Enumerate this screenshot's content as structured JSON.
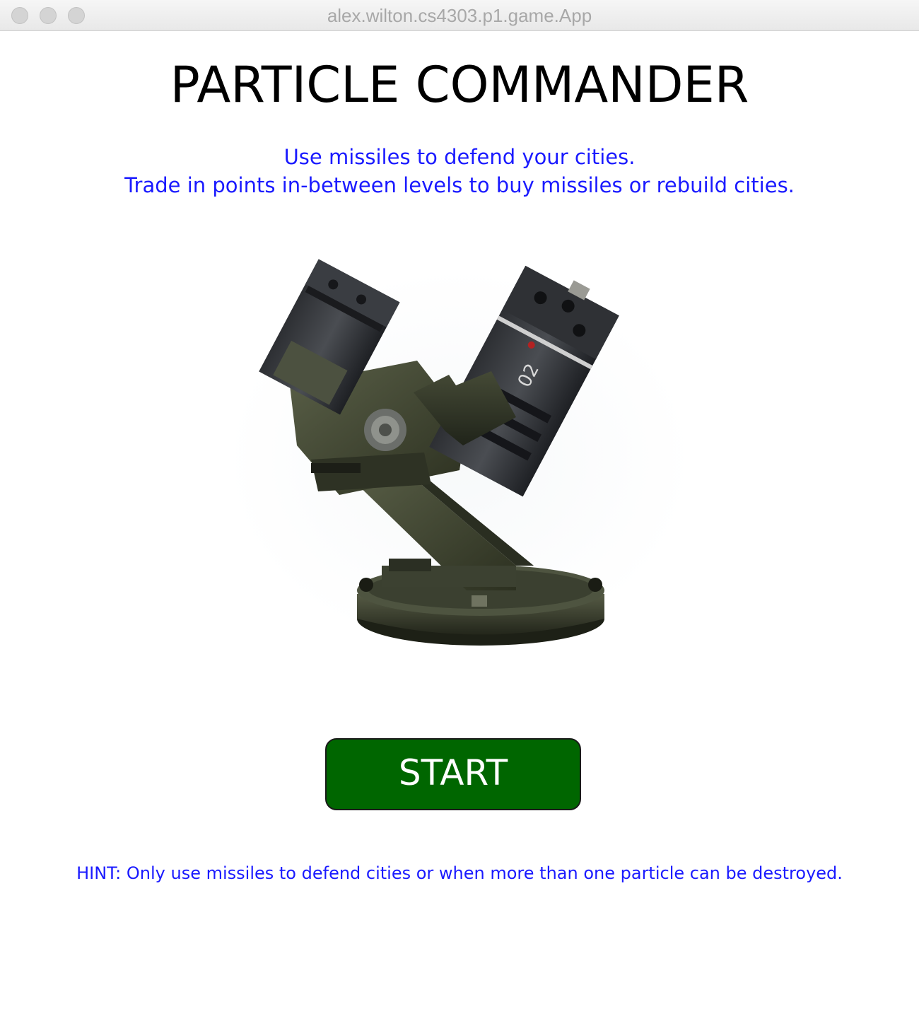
{
  "window": {
    "title": "alex.wilton.cs4303.p1.game.App"
  },
  "menu": {
    "title": "PARTICLE COMMANDER",
    "instructions": [
      "Use missiles to defend your cities.",
      "Trade in points in-between levels to buy missiles or rebuild cities."
    ],
    "start_label": "START",
    "hint": "HINT: Only use missiles to defend cities or when more than one particle can be destroyed.",
    "image": "missile-launcher-turret",
    "colors": {
      "title": "#000000",
      "instruction_text": "#1a1aff",
      "button_bg": "#006600",
      "button_text": "#ffffff",
      "background": "#ffffff"
    }
  }
}
